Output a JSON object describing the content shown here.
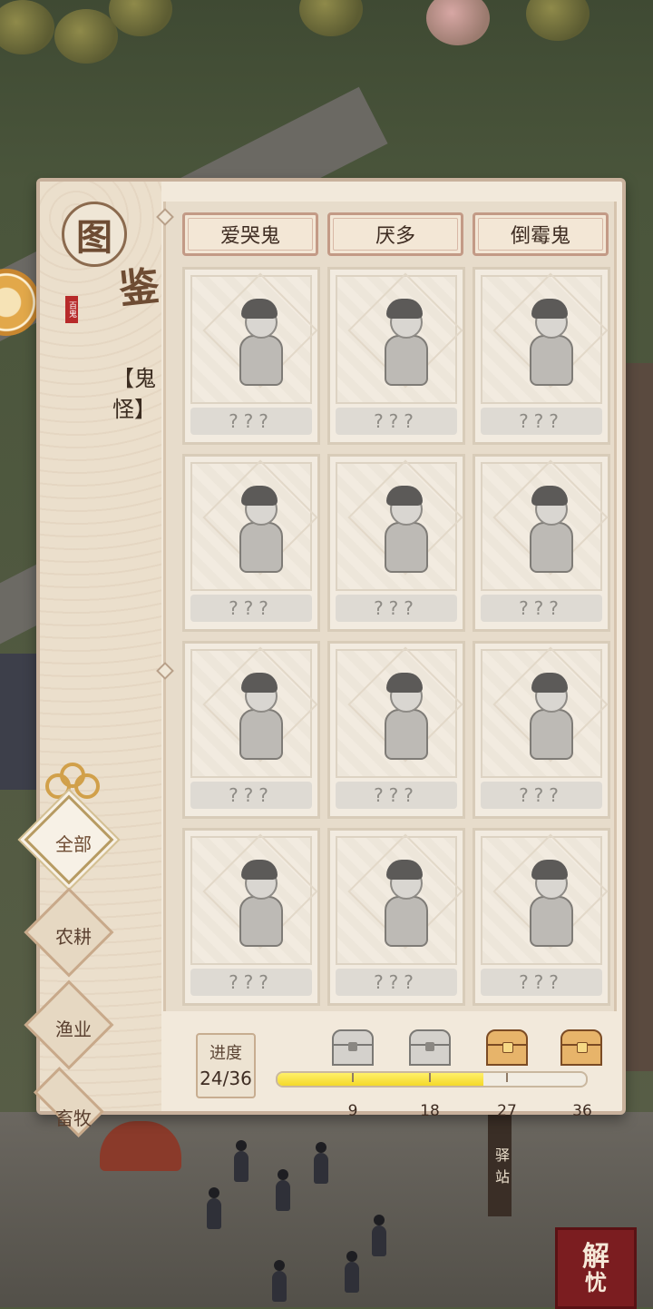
{
  "panel": {
    "title_char_1": "图",
    "title_char_2": "鉴",
    "stamp": "百鬼",
    "category": "【鬼怪】"
  },
  "filters": [
    {
      "label": "全部",
      "active": true
    },
    {
      "label": "农耕",
      "active": false
    },
    {
      "label": "渔业",
      "active": false
    },
    {
      "label": "畜牧",
      "active": false
    }
  ],
  "collection": {
    "named": [
      "爱哭鬼",
      "厌多",
      "倒霉鬼"
    ],
    "cards": [
      {
        "hidden_label": "???"
      },
      {
        "hidden_label": "???"
      },
      {
        "hidden_label": "???"
      },
      {
        "hidden_label": "???"
      },
      {
        "hidden_label": "???"
      },
      {
        "hidden_label": "???"
      },
      {
        "hidden_label": "???"
      },
      {
        "hidden_label": "???"
      },
      {
        "hidden_label": "???"
      },
      {
        "hidden_label": "???"
      },
      {
        "hidden_label": "???"
      },
      {
        "hidden_label": "???"
      }
    ]
  },
  "progress": {
    "label": "进度",
    "text": "24/36",
    "current": 24,
    "max": 36,
    "milestones": [
      {
        "value": "9",
        "reward": "chest-icon",
        "claimed": true
      },
      {
        "value": "18",
        "reward": "chest-icon",
        "claimed": true
      },
      {
        "value": "27",
        "reward": "chest-icon",
        "claimed": false
      },
      {
        "value": "36",
        "reward": "chest-icon",
        "claimed": false
      }
    ]
  },
  "world": {
    "station_sign": "驿站",
    "jieyou_1": "解",
    "jieyou_2": "忧"
  },
  "colors": {
    "accent": "#c39a86",
    "progress_fill": "#f4d92a",
    "panel_bg": "#f2e9db"
  }
}
